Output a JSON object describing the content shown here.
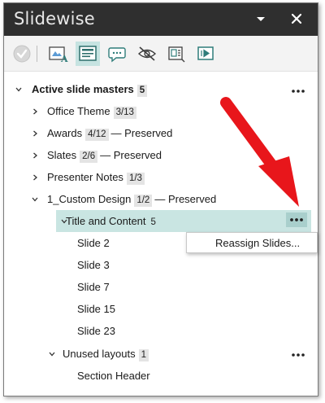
{
  "panel": {
    "title": "Slidewise",
    "title_color": "#2f2f2f",
    "accent_color": "#c6e3e1",
    "selected_row_color": "#c9e5e2"
  },
  "toolbar": {
    "icons": [
      "check-circle-icon",
      "slide-text-icon",
      "slide-layout-icon",
      "comment-icon",
      "hidden-eye-icon",
      "slide-notes-icon",
      "slide-transition-icon"
    ],
    "active_icon": "slide-layout-icon"
  },
  "tree": {
    "root": {
      "label": "Active slide masters",
      "count": "5"
    },
    "masters": [
      {
        "label": "Office Theme",
        "count": "3/13",
        "note": ""
      },
      {
        "label": "Awards",
        "count": "4/12",
        "note": "— Preserved"
      },
      {
        "label": "Slates",
        "count": "2/6",
        "note": "— Preserved"
      },
      {
        "label": "Presenter Notes",
        "count": "1/3",
        "note": ""
      },
      {
        "label": "1_Custom Design",
        "count": "1/2",
        "note": "— Preserved"
      }
    ],
    "layout": {
      "label": "Title and Content",
      "count": "5"
    },
    "slides": [
      "Slide 2",
      "Slide 3",
      "Slide 7",
      "Slide 15",
      "Slide 23"
    ],
    "unused": {
      "label": "Unused layouts",
      "count": "1"
    },
    "unused_items": [
      "Section Header"
    ]
  },
  "context_menu": {
    "items": [
      "Reassign Slides..."
    ]
  },
  "annotation": {
    "arrow_color": "#e8161b"
  }
}
